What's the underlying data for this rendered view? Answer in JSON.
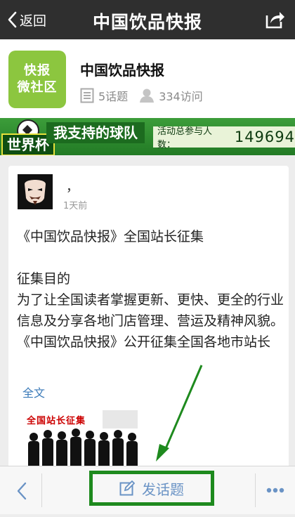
{
  "navbar": {
    "back_label": "返回",
    "title": "中国饮品快报"
  },
  "community": {
    "logo_line1": "快报",
    "logo_line2": "微社区",
    "name": "中国饮品快报",
    "topics": "5话题",
    "visits": "334访问"
  },
  "banner": {
    "event": "世界杯",
    "headline": "我支持的球队",
    "participants_label": "活动总参与人数：",
    "participants_count": "149694"
  },
  "post": {
    "author": "，",
    "time": "1天前",
    "title": "《中国饮品快报》全国站长征集",
    "body_heading": "征集目的",
    "body_text": "为了让全国读者掌握更新、更快、更全的行业信息及分享各地门店管理、营运及精神风貌。《中国饮品快报》公开征集全国各地市站长",
    "read_more": "全文",
    "image_caption": "全国站长征集"
  },
  "toolbar": {
    "compose_label": "发话题"
  },
  "colors": {
    "navbar": "#2f2f2f",
    "logo_green": "#8cc63f",
    "banner_green": "#2e8b2e",
    "link_blue": "#3a7ab8",
    "highlight_green": "#1e8a1e"
  }
}
